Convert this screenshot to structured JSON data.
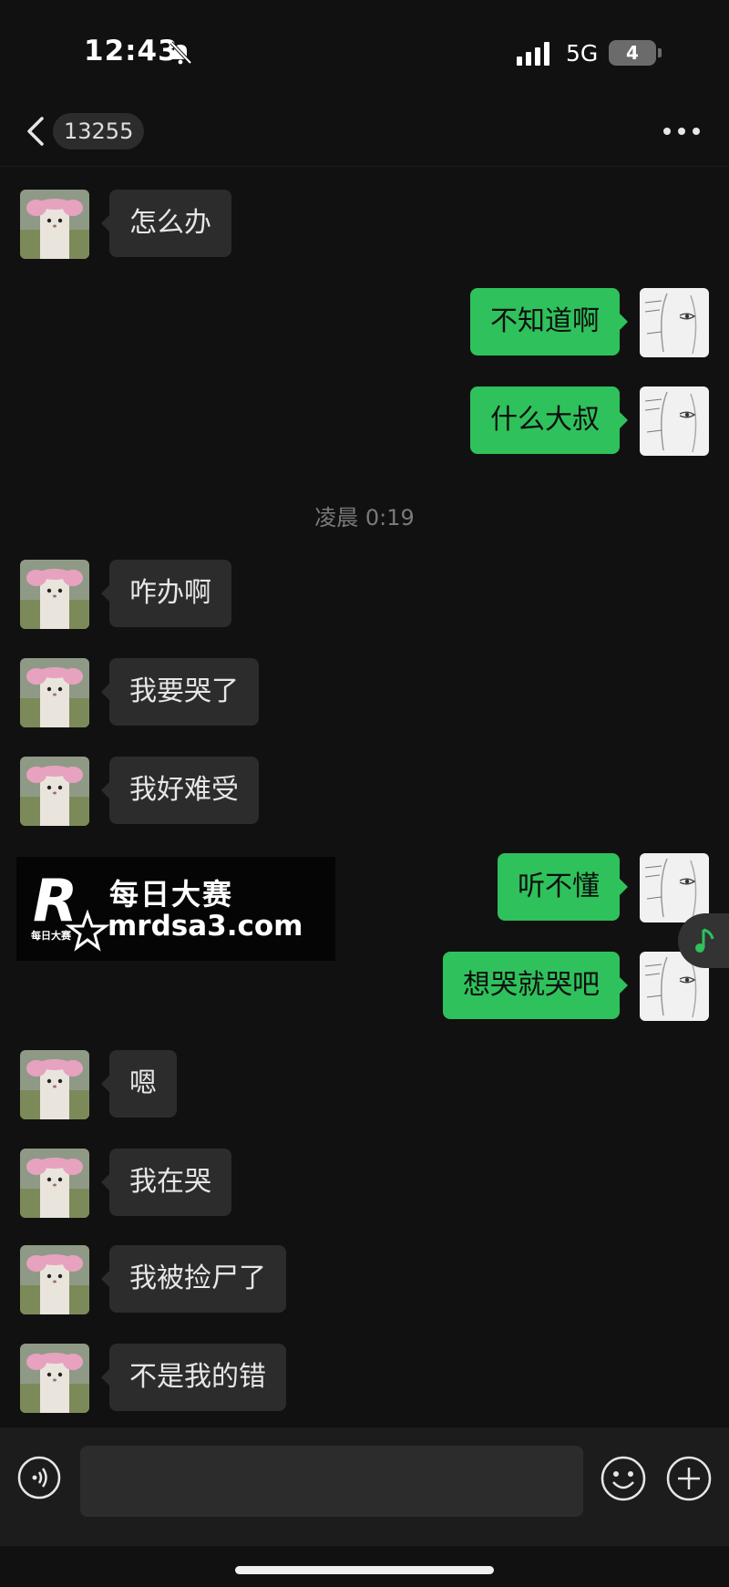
{
  "status_bar": {
    "time": "12:43",
    "network": "5G",
    "battery": "4"
  },
  "nav": {
    "contact": "13255"
  },
  "messages": [
    {
      "side": "in",
      "text": "怎么办"
    },
    {
      "side": "out",
      "text": "不知道啊"
    },
    {
      "side": "out",
      "text": "什么大叔"
    },
    {
      "side": "in",
      "text": "咋办啊"
    },
    {
      "side": "in",
      "text": "我要哭了"
    },
    {
      "side": "in",
      "text": "我好难受"
    },
    {
      "side": "out",
      "text": "听不懂"
    },
    {
      "side": "out",
      "text": "想哭就哭吧"
    },
    {
      "side": "in",
      "text": "嗯"
    },
    {
      "side": "in",
      "text": "我在哭"
    },
    {
      "side": "in",
      "text": "我被捡尸了"
    },
    {
      "side": "in",
      "text": "不是我的错"
    }
  ],
  "timestamp": "凌晨 0:19",
  "watermark": {
    "title": "每日大赛",
    "url": "mrdsa3.com",
    "logo_letter": "R",
    "logo_small": "每日大赛"
  },
  "input": {
    "value": ""
  },
  "icons": {
    "back": "chevron-left-icon",
    "more": "more-icon",
    "bell": "bell-off-icon",
    "voice": "voice-icon",
    "emoji": "emoji-icon",
    "plus": "plus-icon",
    "music": "music-note-icon"
  },
  "colors": {
    "background": "#111111",
    "bubble_in": "#2c2c2c",
    "bubble_out": "#2fc15b"
  }
}
